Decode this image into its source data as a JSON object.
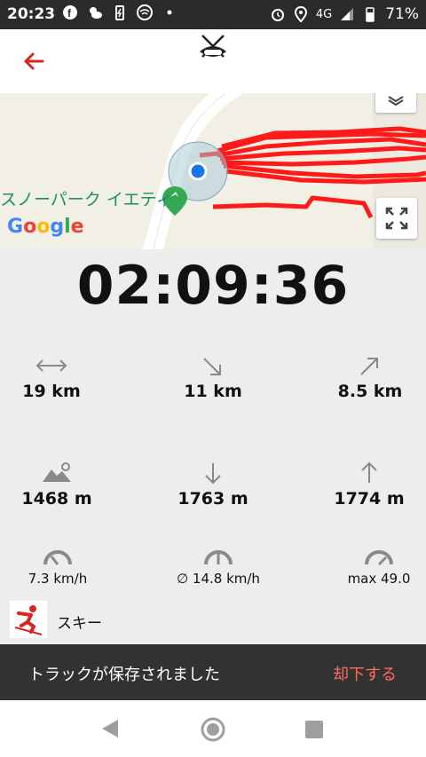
{
  "status_bar": {
    "time": "20:23",
    "network": "4G",
    "battery": "71%",
    "icons": [
      "facebook-icon",
      "weather-icon",
      "battery-saver-icon",
      "wifi-icon",
      "dot-icon",
      "alarm-icon",
      "location-icon",
      "signal-icon",
      "battery-icon"
    ]
  },
  "app_bar": {
    "back_icon": "back-arrow-icon",
    "logo_icon": "ski-logo-icon"
  },
  "map": {
    "place_label": "スノーパーク イエティ",
    "attribution": [
      "G",
      "o",
      "o",
      "g",
      "l",
      "e"
    ],
    "track_color": "#ff1a1a",
    "location_color": "#1a73e8"
  },
  "timer": "02:09:36",
  "stats": [
    {
      "icon": "distance-icon",
      "value": "19 km"
    },
    {
      "icon": "descent-distance-icon",
      "value": "11 km"
    },
    {
      "icon": "ascent-distance-icon",
      "value": "8.5 km"
    },
    {
      "icon": "altitude-icon",
      "value": "1468 m"
    },
    {
      "icon": "descent-icon",
      "value": "1763 m"
    },
    {
      "icon": "ascent-icon",
      "value": "1774 m"
    },
    {
      "icon": "speedometer-icon",
      "value": "7.3 km/h"
    },
    {
      "icon": "avg-speed-icon",
      "value": "∅ 14.8 km/h"
    },
    {
      "icon": "max-speed-icon",
      "value": "max 49.0"
    }
  ],
  "activity": {
    "icon": "skier-icon",
    "label": "スキー"
  },
  "snackbar": {
    "message": "トラックが保存されました",
    "action": "却下する"
  },
  "nav_bar": {
    "icons": [
      "nav-back-icon",
      "nav-home-icon",
      "nav-recents-icon"
    ]
  },
  "colors": {
    "accent": "#d8261f",
    "snackbar_action": "#ff6c5e",
    "track": "#ff1a1a"
  }
}
